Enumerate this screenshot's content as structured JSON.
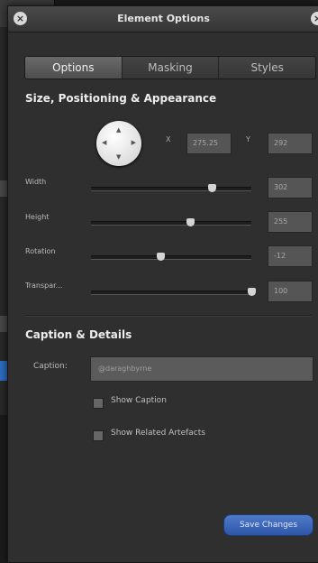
{
  "window": {
    "title": "Element Options"
  },
  "tabs": [
    {
      "label": "Options",
      "active": true
    },
    {
      "label": "Masking",
      "active": false
    },
    {
      "label": "Styles",
      "active": false
    }
  ],
  "size_section": {
    "title": "Size, Positioning & Appearance",
    "x_label": "X",
    "x_value": "275.25",
    "y_label": "Y",
    "y_value": "292",
    "rows": [
      {
        "label": "Width",
        "value": "302",
        "slider_fraction": 0.75
      },
      {
        "label": "Height",
        "value": "255",
        "slider_fraction": 0.62
      },
      {
        "label": "Rotation",
        "value": "-12",
        "slider_fraction": 0.43
      },
      {
        "label": "Transpar...",
        "value": "100",
        "slider_fraction": 1.0
      }
    ]
  },
  "caption_section": {
    "title": "Caption & Details",
    "caption_label": "Caption:",
    "caption_value": "@daraghbyrne",
    "show_caption_label": "Show Caption",
    "show_caption_checked": false,
    "show_related_label": "Show Related Artefacts",
    "show_related_checked": false
  },
  "actions": {
    "save_label": "Save Changes"
  },
  "colors": {
    "panel_bg": "#2f2f2f",
    "accent_button": "#3d67b8"
  }
}
